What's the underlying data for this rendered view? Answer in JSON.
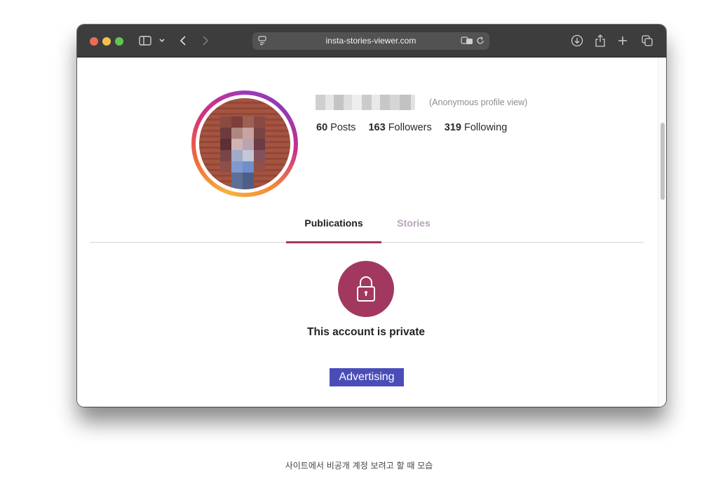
{
  "browser": {
    "url": "insta-stories-viewer.com",
    "icons": [
      "sidebar-icon",
      "chevron-down-icon",
      "back-icon",
      "forward-icon",
      "site-settings-icon",
      "translate-icon",
      "reload-icon",
      "downloads-icon",
      "share-icon",
      "new-tab-icon",
      "tab-overview-icon"
    ]
  },
  "profile": {
    "anonymous_note": "(Anonymous profile view)",
    "stats": [
      {
        "count": "60",
        "label": "Posts"
      },
      {
        "count": "163",
        "label": "Followers"
      },
      {
        "count": "319",
        "label": "Following"
      }
    ]
  },
  "tabs": {
    "active": "Publications",
    "inactive": "Stories"
  },
  "private": {
    "message": "This account is private"
  },
  "advertising": {
    "label": "Advertising"
  },
  "caption": "사이트에서 비공개 계정 보려고 할 때 모습",
  "colors": {
    "accent": "#a2385f",
    "ad_button": "#4a4db8",
    "titlebar": "#3d3d3d",
    "tab_inactive": "#b5a3b8"
  }
}
